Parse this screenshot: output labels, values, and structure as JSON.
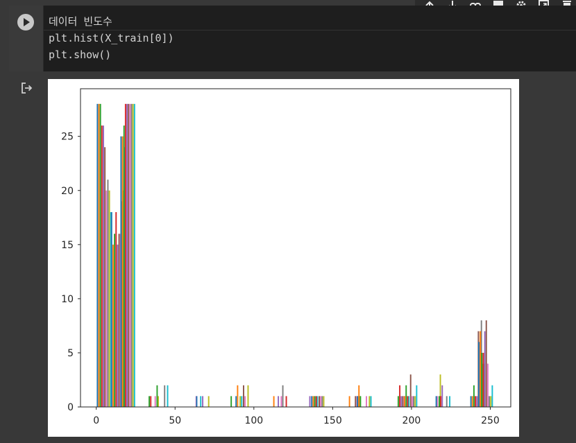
{
  "toolbar": {
    "buttons": [
      {
        "icon": "arrow-up-icon",
        "label": "↑"
      },
      {
        "icon": "arrow-down-icon",
        "label": "↓"
      },
      {
        "icon": "link-icon",
        "label": "🔗"
      },
      {
        "icon": "comment-icon",
        "label": "■"
      },
      {
        "icon": "gear-icon",
        "label": "⚙"
      },
      {
        "icon": "open-in-tab-icon",
        "label": "⧉"
      },
      {
        "icon": "trash-icon",
        "label": "🗑"
      }
    ]
  },
  "cell": {
    "code_lines": [
      "데이터 빈도수",
      "plt.hist(X_train[0])",
      "plt.show()"
    ]
  },
  "output": {
    "icon": "output-redirect-icon"
  },
  "chart_data": {
    "type": "bar",
    "title": "",
    "xlabel": "",
    "ylabel": "",
    "xlim": [
      -10,
      263
    ],
    "ylim": [
      0,
      29.4
    ],
    "xticks": [
      0,
      50,
      100,
      150,
      200,
      250
    ],
    "yticks": [
      0,
      5,
      10,
      15,
      20,
      25
    ],
    "xtick_labels": [
      "0",
      "50",
      "100",
      "150",
      "200",
      "250"
    ],
    "ytick_labels": [
      "0",
      "5",
      "10",
      "15",
      "20",
      "25"
    ],
    "colors": [
      "#1f77b4",
      "#ff7f0e",
      "#2ca02c",
      "#d62728",
      "#9467bd",
      "#8c564b",
      "#e377c2",
      "#7f7f7f",
      "#bcbd22",
      "#17becf"
    ],
    "bin_groups": [
      {
        "x": 5,
        "values": [
          28,
          28,
          28,
          26,
          26,
          24,
          20,
          21,
          20,
          18
        ]
      },
      {
        "x": 14,
        "values": [
          18,
          15,
          16,
          18,
          15,
          16,
          16,
          19,
          20,
          24
        ]
      },
      {
        "x": 20,
        "values": [
          25,
          25,
          26,
          28,
          28,
          28,
          28,
          28,
          28,
          28
        ]
      },
      {
        "x": 36,
        "values": [
          0,
          0,
          1,
          1,
          0,
          0,
          1,
          0,
          1,
          0
        ]
      },
      {
        "x": 41,
        "values": [
          0,
          0,
          2,
          0,
          0,
          0,
          0,
          2,
          0,
          2
        ]
      },
      {
        "x": 62,
        "values": [
          0,
          0,
          0,
          0,
          0,
          0,
          1,
          0,
          0,
          1
        ]
      },
      {
        "x": 68,
        "values": [
          1,
          0,
          0,
          0,
          1,
          0,
          0,
          0,
          1,
          0
        ]
      },
      {
        "x": 88,
        "values": [
          0,
          0,
          1,
          0,
          0,
          0,
          0,
          0,
          1,
          1
        ]
      },
      {
        "x": 93,
        "values": [
          1,
          2,
          0,
          0,
          0,
          2,
          1,
          0,
          2,
          0
        ]
      },
      {
        "x": 116,
        "values": [
          0,
          1,
          0,
          0,
          1,
          0,
          1,
          2,
          0,
          0
        ]
      },
      {
        "x": 122,
        "values": [
          0,
          0,
          0,
          1,
          0,
          0,
          0,
          0,
          0,
          0
        ]
      },
      {
        "x": 136,
        "values": [
          0,
          0,
          0,
          0,
          1,
          0,
          0,
          0,
          0,
          1
        ]
      },
      {
        "x": 141,
        "values": [
          1,
          1,
          1,
          1,
          0,
          1,
          1,
          1,
          1,
          0
        ]
      },
      {
        "x": 164,
        "values": [
          0,
          1,
          0,
          0,
          0,
          1,
          1,
          1,
          1,
          0
        ]
      },
      {
        "x": 170,
        "values": [
          1,
          2,
          1,
          0,
          0,
          0,
          1,
          0,
          1,
          1
        ]
      },
      {
        "x": 194,
        "values": [
          0,
          0,
          1,
          2,
          1,
          1,
          1,
          0,
          0,
          1
        ]
      },
      {
        "x": 199,
        "values": [
          0,
          1,
          2,
          1,
          0,
          3,
          1,
          1,
          1,
          2
        ]
      },
      {
        "x": 215,
        "values": [
          0,
          0,
          0,
          0,
          0,
          0,
          1,
          0,
          3,
          0
        ]
      },
      {
        "x": 220,
        "values": [
          1,
          0,
          1,
          1,
          2,
          0,
          0,
          1,
          0,
          1
        ]
      },
      {
        "x": 242,
        "values": [
          1,
          1,
          2,
          1,
          1,
          7,
          6,
          8,
          4,
          4
        ]
      },
      {
        "x": 247,
        "values": [
          6,
          7,
          5,
          5,
          7,
          8,
          4,
          1,
          1,
          2
        ]
      }
    ]
  }
}
